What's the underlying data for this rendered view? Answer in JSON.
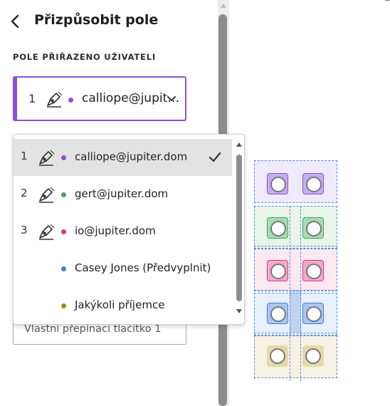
{
  "panel": {
    "title": "Přizpůsobit pole",
    "section_label": "POLE PŘIŘAZENO UŽIVATELI",
    "selected_recipient": {
      "number": "1",
      "email": "calliope@jupit…",
      "color": "#8c4fd6"
    },
    "hidden_field_value": "Vlastní přepínací tlačítko 1"
  },
  "dropdown": {
    "options": [
      {
        "number": "1",
        "label": "calliope@jupiter.dom",
        "color": "#8c4fd6",
        "icon": "pen-icon",
        "selected": true
      },
      {
        "number": "2",
        "label": "gert@jupiter.dom",
        "color": "#3ea65a",
        "icon": "pen-icon",
        "selected": false
      },
      {
        "number": "3",
        "label": "io@jupiter.dom",
        "color": "#d8358a",
        "icon": "pen-icon",
        "selected": false
      },
      {
        "number": "",
        "label": "Casey Jones (Předvyplnit)",
        "color": "#3e7fe0",
        "icon": "",
        "selected": false
      },
      {
        "number": "",
        "label": "Jakýkoli příjemce",
        "color": "#a28c0e",
        "icon": "",
        "selected": false
      }
    ]
  },
  "colors": {
    "accent": "#8c4fd6",
    "purple": "#8c4fd6",
    "green": "#3ea65a",
    "pink": "#d8358a",
    "blue": "#3e7fe0",
    "olive": "#a28c0e"
  }
}
